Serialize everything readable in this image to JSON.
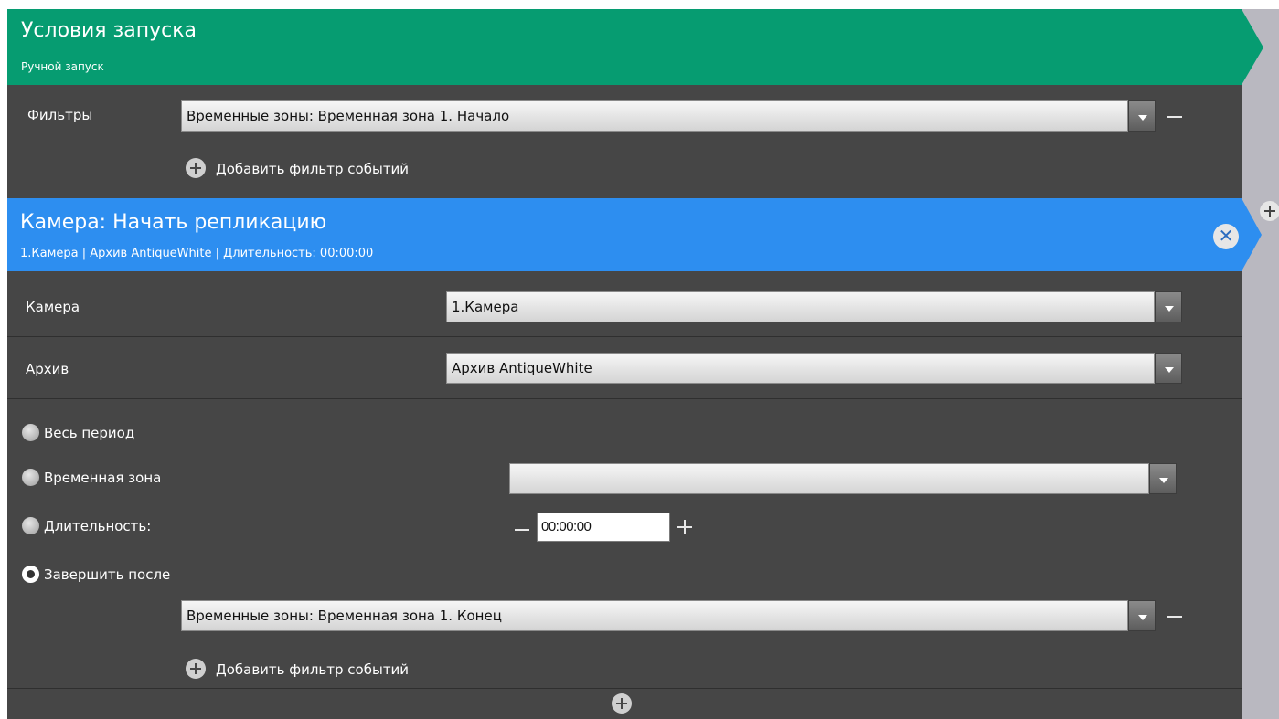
{
  "trigger": {
    "title": "Условия запуска",
    "subtitle": "Ручной запуск",
    "filters_label": "Фильтры",
    "filter_value": "Временные зоны: Временная зона 1. Начало",
    "add_filter_label": "Добавить фильтр событий",
    "color": "#069c71"
  },
  "action": {
    "title": "Камера: Начать репликацию",
    "subtitle": "1.Камера | Архив AntiqueWhite | Длительность: 00:00:00",
    "color": "#2d8ef0",
    "close_glyph": "✕",
    "camera_label": "Камера",
    "camera_value": "1.Камера",
    "archive_label": "Архив",
    "archive_value": "Архив AntiqueWhite",
    "options": {
      "whole_period": "Весь период",
      "time_zone": "Временная зона",
      "time_zone_value": "",
      "duration": "Длительность:",
      "duration_value": "00:00:00",
      "finish_after": "Завершить после",
      "selected": "finish_after"
    },
    "finish_filter_value": "Временные зоны: Временная зона 1. Конец",
    "add_filter_label": "Добавить фильтр событий"
  }
}
